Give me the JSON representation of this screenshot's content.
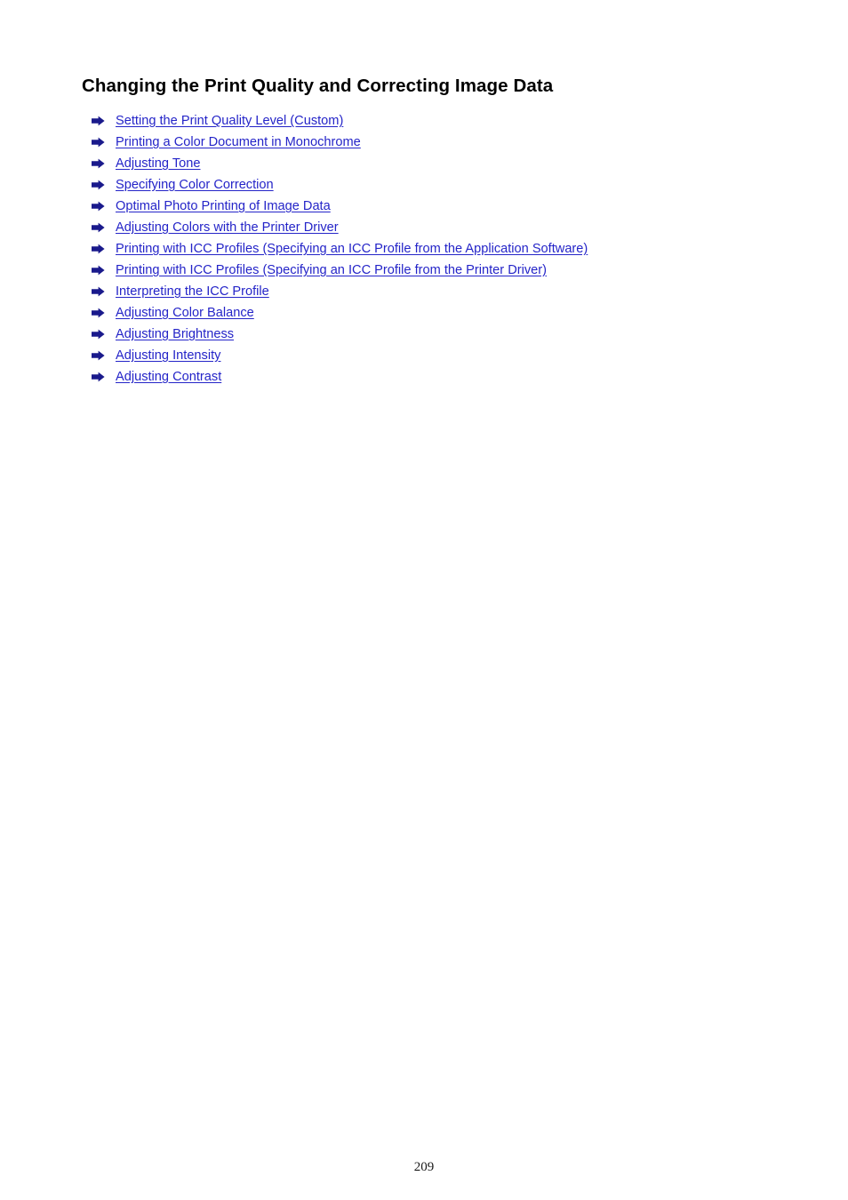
{
  "document": {
    "title": "Changing the Print Quality and Correcting Image Data",
    "page_number": "209",
    "background_color": "#ffffff",
    "link_color": "#2424c8",
    "arrow_color": "#1a1a8c",
    "title_color": "#000000"
  },
  "links": [
    {
      "label": "Setting the Print Quality Level (Custom)",
      "icon": "arrow-right-icon"
    },
    {
      "label": "Printing a Color Document in Monochrome",
      "icon": "arrow-right-icon"
    },
    {
      "label": "Adjusting Tone",
      "icon": "arrow-right-icon"
    },
    {
      "label": "Specifying Color Correction",
      "icon": "arrow-right-icon"
    },
    {
      "label": "Optimal Photo Printing of Image Data",
      "icon": "arrow-right-icon"
    },
    {
      "label": "Adjusting Colors with the Printer Driver",
      "icon": "arrow-right-icon"
    },
    {
      "label": "Printing with ICC Profiles (Specifying an ICC Profile from the Application Software)",
      "icon": "arrow-right-icon"
    },
    {
      "label": "Printing with ICC Profiles (Specifying an ICC Profile from the Printer Driver)",
      "icon": "arrow-right-icon"
    },
    {
      "label": "Interpreting the ICC Profile",
      "icon": "arrow-right-icon"
    },
    {
      "label": "Adjusting Color Balance",
      "icon": "arrow-right-icon"
    },
    {
      "label": "Adjusting Brightness",
      "icon": "arrow-right-icon"
    },
    {
      "label": "Adjusting Intensity",
      "icon": "arrow-right-icon"
    },
    {
      "label": "Adjusting Contrast",
      "icon": "arrow-right-icon"
    }
  ]
}
